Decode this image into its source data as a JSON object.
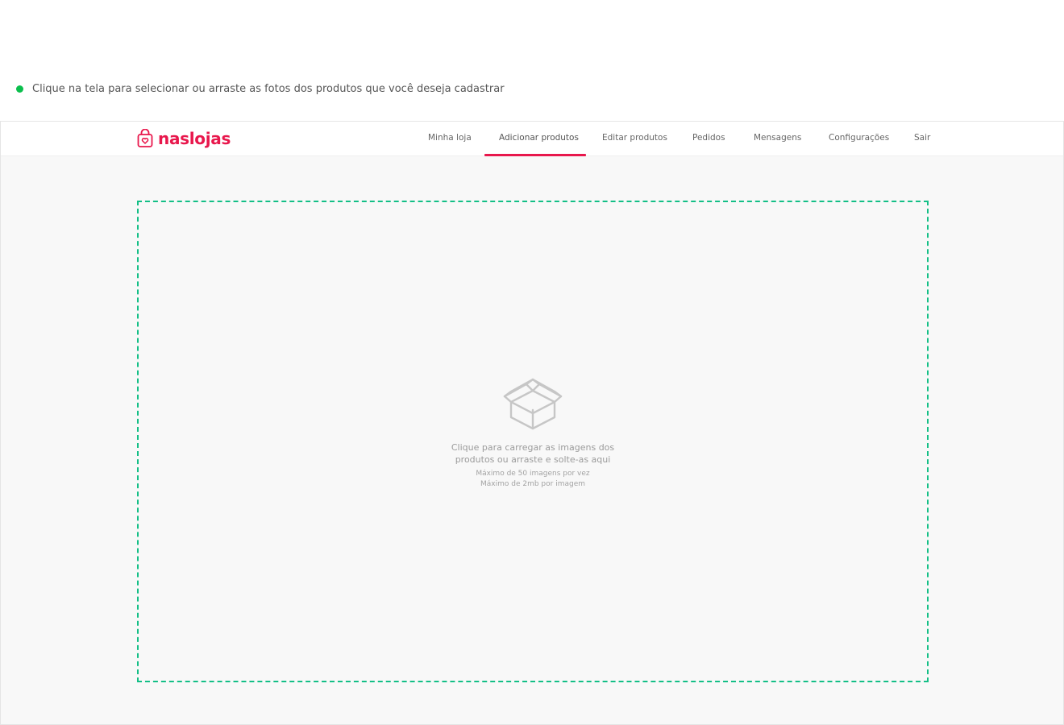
{
  "instruction": {
    "text": "Clique na tela para selecionar ou arraste as fotos dos produtos que você deseja cadastrar",
    "dot_color": "#0bbf4d"
  },
  "brand": {
    "name": "naslojas",
    "color": "#e8174c",
    "icon": "shopping-bag-heart-icon"
  },
  "nav": {
    "items": [
      {
        "label": "Minha loja"
      },
      {
        "label": "Adicionar produtos",
        "active": true
      },
      {
        "label": "Editar produtos"
      },
      {
        "label": "Pedidos"
      },
      {
        "label": "Mensagens"
      },
      {
        "label": "Configurações"
      },
      {
        "label": "Sair"
      }
    ]
  },
  "dropzone": {
    "icon": "open-box-icon",
    "border_color": "#13bf86",
    "line1": "Clique para carregar as imagens dos",
    "line2": "produtos ou arraste e solte-as aqui",
    "limit_count": "Máximo de 50 imagens por vez",
    "limit_size": "Máximo de 2mb por imagem"
  }
}
